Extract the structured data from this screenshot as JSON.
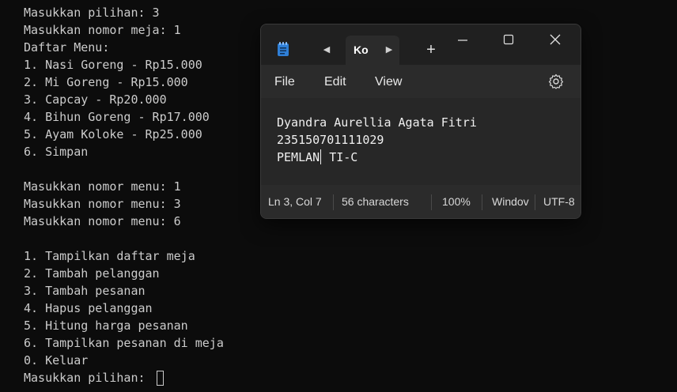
{
  "terminal": {
    "lines": [
      "Masukkan pilihan: 3",
      "Masukkan nomor meja: 1",
      "Daftar Menu:",
      "1. Nasi Goreng - Rp15.000",
      "2. Mi Goreng - Rp15.000",
      "3. Capcay - Rp20.000",
      "4. Bihun Goreng - Rp17.000",
      "5. Ayam Koloke - Rp25.000",
      "6. Simpan",
      "",
      "Masukkan nomor menu: 1",
      "Masukkan nomor menu: 3",
      "Masukkan nomor menu: 6",
      "",
      "1. Tampilkan daftar meja",
      "2. Tambah pelanggan",
      "3. Tambah pesanan",
      "4. Hapus pelanggan",
      "5. Hitung harga pesanan",
      "6. Tampilkan pesanan di meja",
      "0. Keluar",
      "Masukkan pilihan: "
    ],
    "text_color": "#cccccc",
    "background": "#0c0c0c"
  },
  "notepad": {
    "tab_label": "Ko",
    "app_icon": "notepad-icon",
    "menu": {
      "file": "File",
      "edit": "Edit",
      "view": "View"
    },
    "content": {
      "line1": "Dyandra Aurellia Agata Fitri",
      "line2": "235150701111029",
      "line3_before_caret": "PEMLAN",
      "line3_after_caret": " TI-C"
    },
    "status": {
      "position": "Ln 3, Col 7",
      "characters": "56 characters",
      "zoom": "100%",
      "line_ending": "Windov",
      "encoding": "UTF-8"
    },
    "icons": {
      "back": "chevron-left-icon",
      "forward": "chevron-right-icon",
      "new_tab": "plus-icon",
      "minimize": "minimize-icon",
      "maximize": "maximize-icon",
      "close": "close-icon",
      "settings": "gear-icon"
    },
    "colors": {
      "titlebar": "#202020",
      "menubar": "#2b2b2b",
      "editor": "#272727",
      "icon_blue": "#2f7fd6"
    }
  }
}
